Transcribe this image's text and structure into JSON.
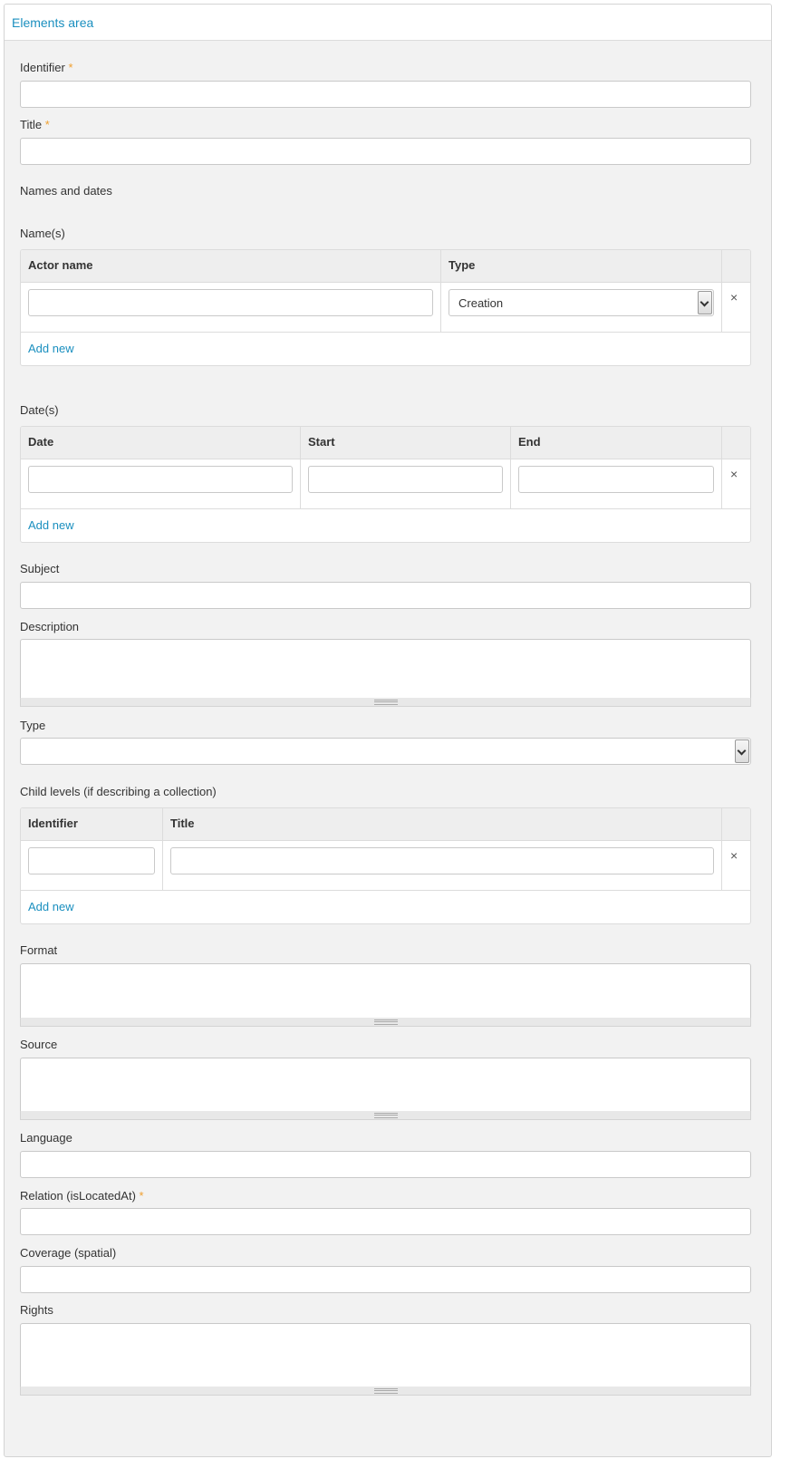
{
  "panel": {
    "title": "Elements area"
  },
  "fields": {
    "identifier": {
      "label": "Identifier",
      "required": "*",
      "value": ""
    },
    "title": {
      "label": "Title",
      "required": "*",
      "value": ""
    },
    "names_and_dates": {
      "label": "Names and dates"
    },
    "subject": {
      "label": "Subject",
      "value": ""
    },
    "description": {
      "label": "Description",
      "value": ""
    },
    "type": {
      "label": "Type",
      "value": ""
    },
    "format": {
      "label": "Format",
      "value": ""
    },
    "source": {
      "label": "Source",
      "value": ""
    },
    "language": {
      "label": "Language",
      "value": ""
    },
    "relation": {
      "label": "Relation (isLocatedAt)",
      "required": "*",
      "value": ""
    },
    "coverage": {
      "label": "Coverage (spatial)",
      "value": ""
    },
    "rights": {
      "label": "Rights",
      "value": ""
    }
  },
  "names_table": {
    "label": "Name(s)",
    "columns": [
      "Actor name",
      "Type"
    ],
    "row": {
      "actor_name": "",
      "type": "Creation"
    },
    "remove": "×",
    "add_new": "Add new"
  },
  "dates_table": {
    "label": "Date(s)",
    "columns": [
      "Date",
      "Start",
      "End"
    ],
    "remove": "×",
    "add_new": "Add new"
  },
  "child_table": {
    "label": "Child levels (if describing a collection)",
    "columns": [
      "Identifier",
      "Title"
    ],
    "remove": "×",
    "add_new": "Add new"
  },
  "colors": {
    "link": "#1a8fbf",
    "required": "#f0a030"
  }
}
